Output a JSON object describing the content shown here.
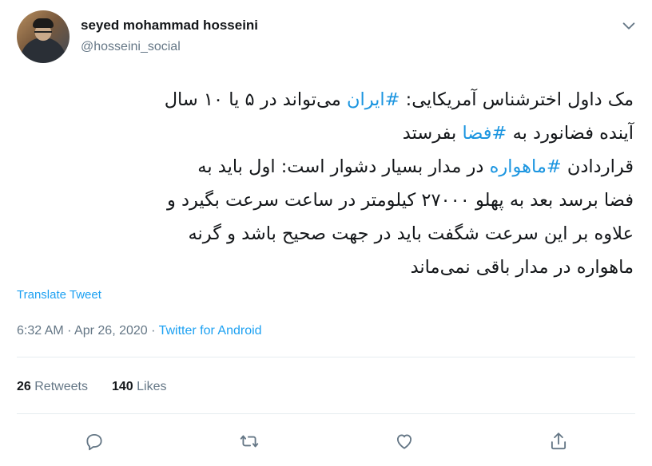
{
  "user": {
    "display_name": "seyed mohammad hosseini",
    "handle": "@hosseini_social"
  },
  "tweet": {
    "lines": [
      [
        "مک داول اخترشناس آمریکایی: ",
        "#ایران",
        " می‌تواند در ۵ یا ۱۰ سال"
      ],
      [
        "آینده فضانورد به ",
        "#فضا",
        " بفرستد"
      ],
      [
        "قراردادن ",
        "#ماهواره",
        " در مدار بسیار دشوار است: اول باید به"
      ],
      [
        "فضا برسد بعد به پهلو ۲۷۰۰۰ کیلومتر در ساعت سرعت بگیرد و",
        "",
        ""
      ],
      [
        "علاوه بر این سرعت شگفت باید در جهت صحیح باشد و گرنه",
        "",
        ""
      ],
      [
        "ماهواره در مدار باقی نمی‌ماند",
        "",
        ""
      ]
    ],
    "translate_label": "Translate Tweet",
    "time": "6:32 AM",
    "separator1": " · ",
    "date": "Apr 26, 2020",
    "separator2": " · ",
    "source": "Twitter for Android"
  },
  "stats": {
    "retweets_count": "26",
    "retweets_label": "Retweets",
    "likes_count": "140",
    "likes_label": "Likes"
  },
  "icons": {
    "menu": "chevron-down-icon",
    "reply": "reply-icon",
    "retweet": "retweet-icon",
    "like": "heart-icon",
    "share": "share-icon"
  },
  "colors": {
    "link": "#1da1f2",
    "hashtag": "#1b95e0",
    "muted": "#657786",
    "text": "#14171a",
    "divider": "#e6ecf0"
  }
}
